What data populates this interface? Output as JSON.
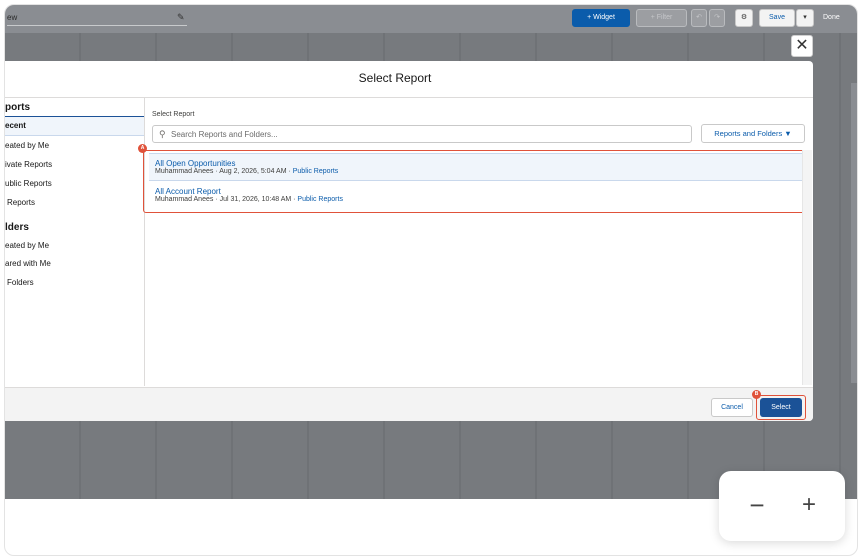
{
  "toolbar": {
    "name_fragment": "ew",
    "widget_label": "+ Widget",
    "filter_label": "+ Filter",
    "undo_glyph": "↶",
    "redo_glyph": "↷",
    "gear_glyph": "⚙",
    "save_label": "Save",
    "save_dropdown_glyph": "▾",
    "done_label": "Done"
  },
  "modal": {
    "title": "Select Report",
    "close_glyph": "✕",
    "sidebar": {
      "reports_heading": "ports",
      "report_items": [
        "ecent",
        "eated by Me",
        "ivate Reports",
        "ublic Reports",
        "Reports"
      ],
      "folders_heading": "lders",
      "folder_items": [
        "eated by Me",
        "ared with Me",
        "Folders"
      ]
    },
    "main": {
      "section_label": "Select Report",
      "search_placeholder": "Search Reports and Folders...",
      "filter_button": "Reports and Folders ▼",
      "results": [
        {
          "title": "All Open Opportunities",
          "meta": "Muhammad Anees · Aug 2, 2026, 5:04 AM · ",
          "folder": "Public Reports"
        },
        {
          "title": "All Account Report",
          "meta": "Muhammad Anees · Jul 31, 2026, 10:48 AM · ",
          "folder": "Public Reports"
        }
      ]
    },
    "footer": {
      "cancel_label": "Cancel",
      "select_label": "Select"
    },
    "markers": {
      "results": "A",
      "select": "B"
    }
  },
  "zoom": {
    "minus_glyph": "−",
    "plus_glyph": "+"
  },
  "colors": {
    "accent": "#0b5cab",
    "highlight": "#e0523a",
    "select_button": "#1b5297"
  }
}
